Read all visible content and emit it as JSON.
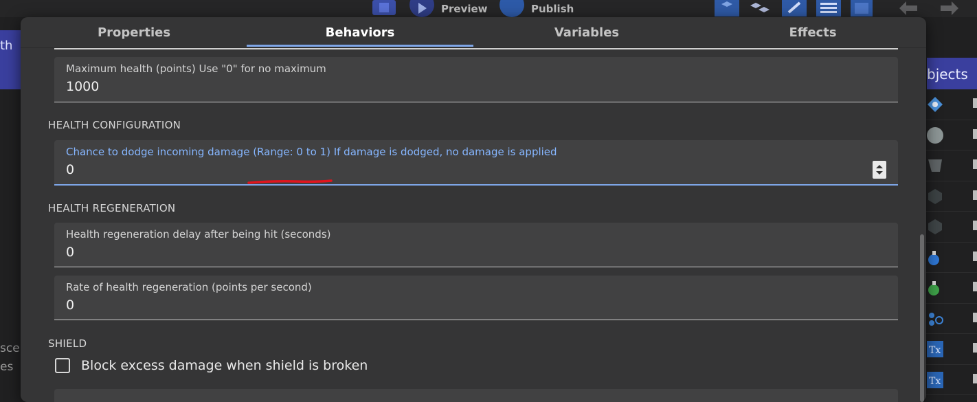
{
  "app_toolbar": {
    "preview_label": "Preview",
    "publish_label": "Publish"
  },
  "background": {
    "left_panel_label": "th",
    "left_text_1": "sce",
    "left_text_2": "es",
    "right_panel_label": "bjects",
    "object_rows": 10
  },
  "tabs": [
    {
      "label": "Properties"
    },
    {
      "label": "Behaviors"
    },
    {
      "label": "Variables"
    },
    {
      "label": "Effects"
    }
  ],
  "active_tab": "Behaviors",
  "fields": {
    "max_health": {
      "label": "Maximum health (points) Use \"0\" for no maximum",
      "value": "1000"
    },
    "dodge_chance": {
      "label": "Chance to dodge incoming damage (Range: 0 to 1) If damage is dodged, no damage is applied",
      "value": "0"
    },
    "regen_delay": {
      "label": "Health regeneration delay after being hit (seconds)",
      "value": "0"
    },
    "regen_rate": {
      "label": "Rate of health regeneration (points per second)",
      "value": "0"
    }
  },
  "sections": {
    "health_configuration": "HEALTH CONFIGURATION",
    "health_regeneration": "HEALTH REGENERATION",
    "shield": "SHIELD"
  },
  "checkboxes": {
    "block_excess_damage": {
      "label": "Block excess damage when shield is broken",
      "checked": false
    }
  },
  "colors": {
    "accent": "#7ea6e8",
    "focused_label": "#86b6ff",
    "annotation": "#e0141e",
    "dialog_bg": "#353536",
    "field_bg": "#414142"
  }
}
